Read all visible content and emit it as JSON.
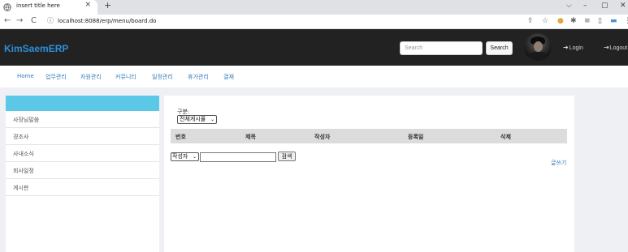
{
  "browser": {
    "tab_title": "insert title here",
    "tab_close": "×",
    "new_tab": "+",
    "url": "localhost:8088/erp/menu/board.do",
    "window_controls": [
      "⌵",
      "–",
      "▢",
      "✕"
    ],
    "nav": {
      "back": "←",
      "forward": "→",
      "reload": "C"
    },
    "extensions": [
      "⇪",
      "☆",
      "●",
      "✱",
      "≡",
      "▯",
      "▬",
      "⋮"
    ]
  },
  "header": {
    "brand": "KimSaemERP",
    "search_placeholder": "Search",
    "search_button": "Search",
    "login_label": "Login",
    "logout_label": "Logout",
    "login_icon": "login-icon",
    "logout_icon": "logout-icon"
  },
  "nav": {
    "items": [
      "Home",
      "업무관리",
      "자원관리",
      "커뮤니티",
      "일정관리",
      "휴가관리",
      "결재"
    ]
  },
  "sidebar": {
    "items": [
      "사장님말씀",
      "경조사",
      "사내소식",
      "회사일정",
      "게시판"
    ]
  },
  "board": {
    "category_label": "구분:",
    "category_selected": "전체게시물",
    "columns": [
      "번호",
      "제목",
      "작성자",
      "등록일",
      "삭제"
    ],
    "search_field_selected": "작성자",
    "search_value": "",
    "search_button": "검색",
    "write_link": "글쓰기"
  },
  "colors": {
    "header_bg": "#222222",
    "brand": "#2d8fd8",
    "sidebar_head": "#5bc8e8",
    "link": "#337ab7"
  }
}
